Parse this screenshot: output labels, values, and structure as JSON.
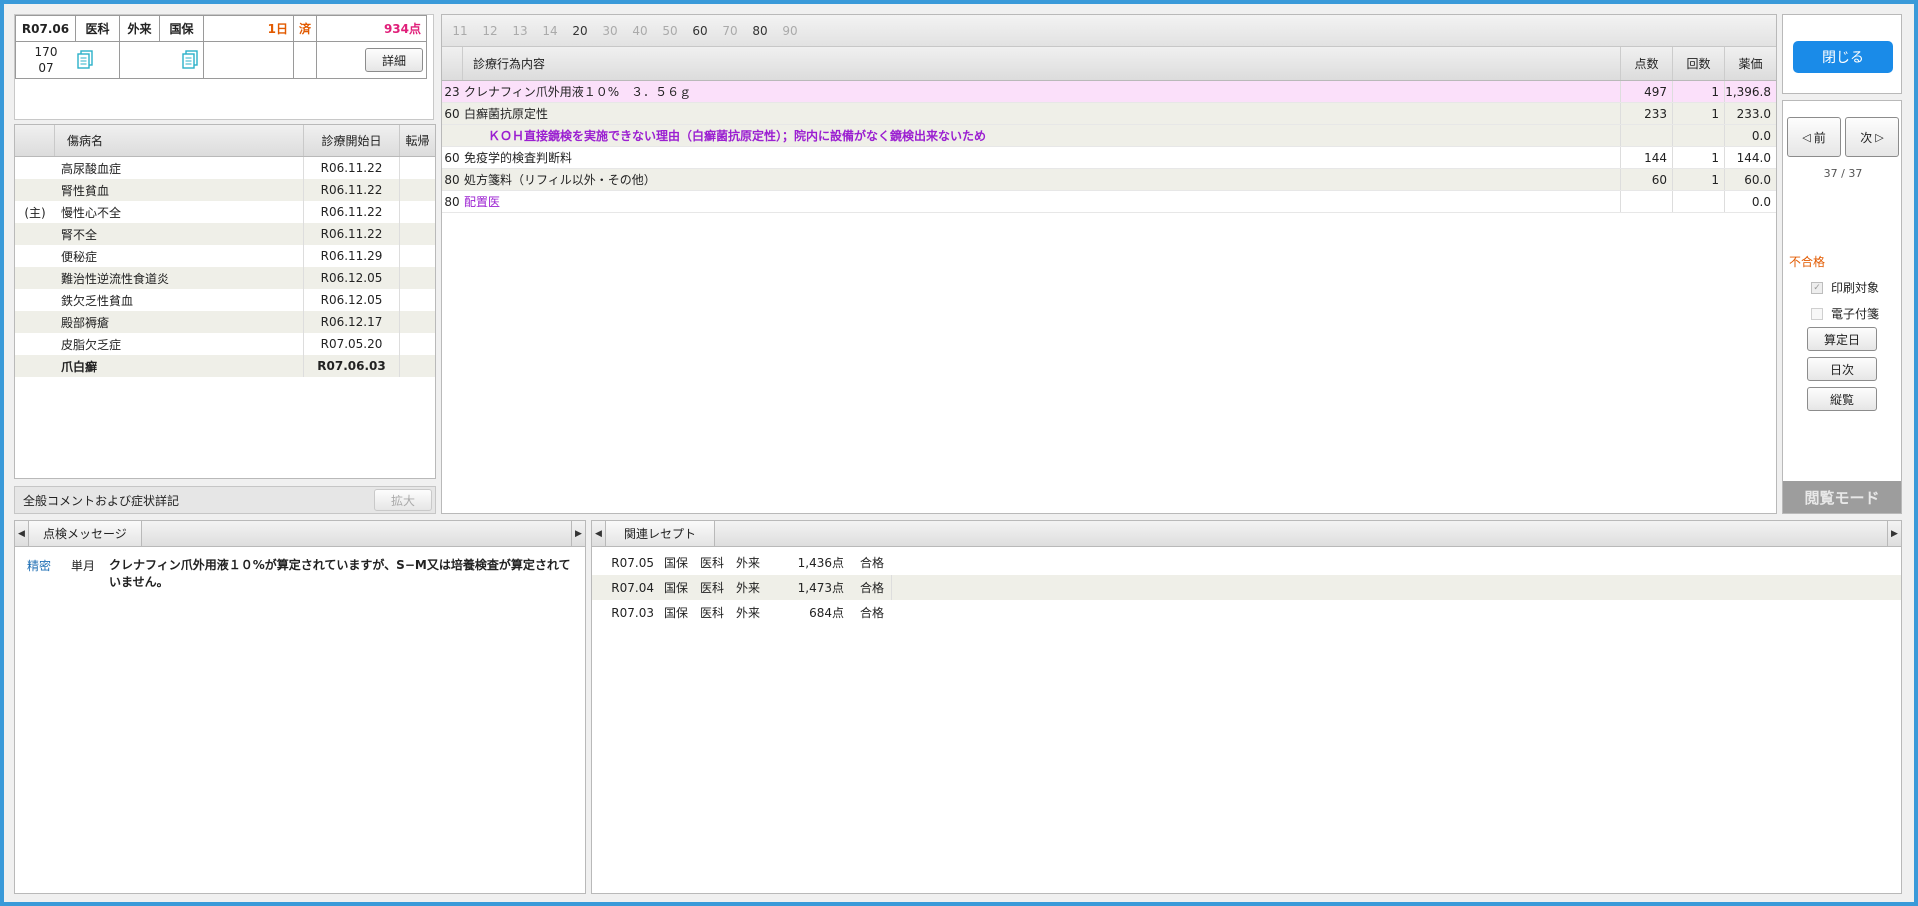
{
  "header": {
    "date": "R07.06",
    "dept": "医科",
    "visit": "外来",
    "insurance": "国保",
    "days": "1日",
    "status": "済",
    "points": "934点",
    "code_line1": "170",
    "code_line2": "07",
    "detail_button": "詳細"
  },
  "diseases": {
    "columns": [
      "傷病名",
      "診療開始日",
      "転帰"
    ],
    "rows": [
      {
        "prefix": "",
        "name": "高尿酸血症",
        "date": "R06.11.22",
        "bold": false
      },
      {
        "prefix": "",
        "name": "腎性貧血",
        "date": "R06.11.22",
        "bold": false
      },
      {
        "prefix": "(主)",
        "name": "慢性心不全",
        "date": "R06.11.22",
        "bold": false
      },
      {
        "prefix": "",
        "name": "腎不全",
        "date": "R06.11.22",
        "bold": false
      },
      {
        "prefix": "",
        "name": "便秘症",
        "date": "R06.11.29",
        "bold": false
      },
      {
        "prefix": "",
        "name": "難治性逆流性食道炎",
        "date": "R06.12.05",
        "bold": false
      },
      {
        "prefix": "",
        "name": "鉄欠乏性貧血",
        "date": "R06.12.05",
        "bold": false
      },
      {
        "prefix": "",
        "name": "殿部褥瘡",
        "date": "R06.12.17",
        "bold": false
      },
      {
        "prefix": "",
        "name": "皮脂欠乏症",
        "date": "R07.05.20",
        "bold": false
      },
      {
        "prefix": "",
        "name": "爪白癬",
        "date": "R07.06.03",
        "bold": true
      }
    ]
  },
  "comment": {
    "label": "全般コメントおよび症状詳記",
    "expand_button": "拡大"
  },
  "day_tabs": [
    "11",
    "12",
    "13",
    "14",
    "20",
    "30",
    "40",
    "50",
    "60",
    "70",
    "80",
    "90"
  ],
  "day_tabs_active": [
    "20",
    "60",
    "80"
  ],
  "treatments": {
    "columns": [
      "診療行為内容",
      "点数",
      "回数",
      "薬価"
    ],
    "rows": [
      {
        "code": "23",
        "content": "クレナフィン爪外用液１０%　３．５６ｇ",
        "points": "497",
        "count": "1",
        "price": "1,396.8",
        "style": "pink"
      },
      {
        "code": "60",
        "content": "白癬菌抗原定性",
        "points": "233",
        "count": "1",
        "price": "233.0",
        "style": "alt"
      },
      {
        "code": "",
        "content": "ＫＯＨ直接鏡検を実施できない理由（白癬菌抗原定性）；院内に設備がなく鏡検出来ないため",
        "points": "",
        "count": "",
        "price": "0.0",
        "style": "purple"
      },
      {
        "code": "60",
        "content": "免疫学的検査判断料",
        "points": "144",
        "count": "1",
        "price": "144.0",
        "style": "plain"
      },
      {
        "code": "80",
        "content": "処方箋料（リフィル以外・その他）",
        "points": "60",
        "count": "1",
        "price": "60.0",
        "style": "alt"
      },
      {
        "code": "80",
        "content": "配置医",
        "points": "",
        "count": "",
        "price": "0.0",
        "style": "purple-plain"
      }
    ]
  },
  "right": {
    "close_button": "閉じる",
    "prev_button": "前",
    "next_button": "次",
    "counter": "37 / 37",
    "result": "不合格",
    "print_target": "印刷対象",
    "sticky_note": "電子付箋",
    "calc_day_button": "算定日",
    "daily_button": "日次",
    "vertical_button": "縦覧",
    "mode": "閲覧モード"
  },
  "messages": {
    "tab": "点検メッセージ",
    "items": [
      {
        "type": "精密",
        "period": "単月",
        "text": "クレナフィン爪外用液１０%が算定されていますが、S−M又は培養検査が算定されていません。"
      }
    ]
  },
  "related": {
    "tab": "関連レセプト",
    "rows": [
      {
        "month": "R07.05",
        "ins": "国保",
        "dept": "医科",
        "visit": "外来",
        "points": "1,436点",
        "result": "合格"
      },
      {
        "month": "R07.04",
        "ins": "国保",
        "dept": "医科",
        "visit": "外来",
        "points": "1,473点",
        "result": "合格"
      },
      {
        "month": "R07.03",
        "ins": "国保",
        "dept": "医科",
        "visit": "外来",
        "points": "684点",
        "result": "合格"
      }
    ]
  },
  "colors": {
    "accent": "#1a8be8",
    "frame": "#3a9ad9",
    "pink_row": "#fbe0fa",
    "alt_row": "#efefe8",
    "purple": "#9b1fd1",
    "fail": "#e25a00"
  }
}
